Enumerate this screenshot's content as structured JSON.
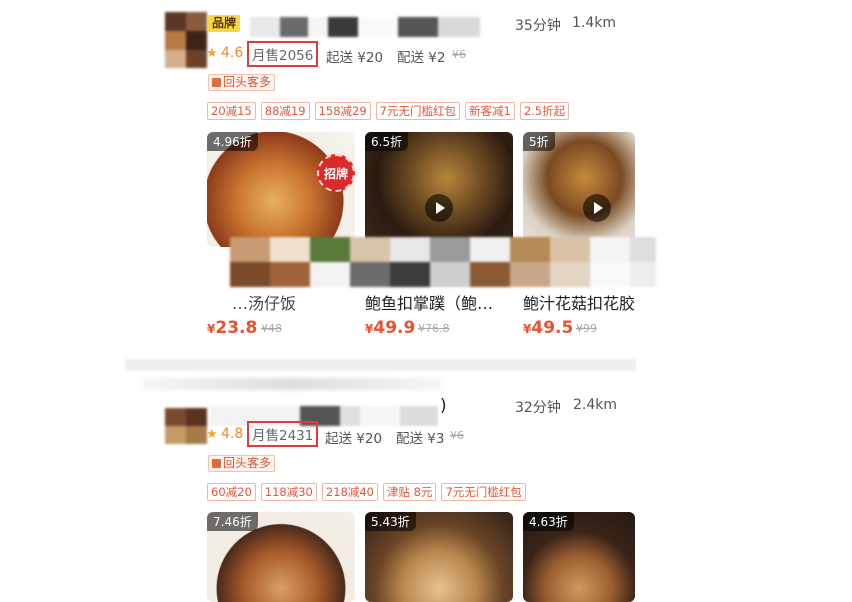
{
  "store1": {
    "badge": "品牌",
    "time": "35分钟",
    "distance": "1.4km",
    "rating": "4.6",
    "monthly_sales": "月售2056",
    "min_order": "起送 ¥20",
    "delivery_fee": "配送 ¥2",
    "delivery_fee_original": "¥6",
    "repeat_tag": "回头客多",
    "promos": [
      "20减15",
      "88减19",
      "158减29",
      "7元无门槛红包",
      "新客减1",
      "2.5折起"
    ],
    "dishes": [
      {
        "discount": "4.96折",
        "name": "…汤仔饭",
        "price": "23.8",
        "original": "¥48",
        "signature": "招牌"
      },
      {
        "discount": "6.5折",
        "name": "鲍鱼扣掌蹼（鲍…",
        "price": "49.9",
        "original": "¥76.8"
      },
      {
        "discount": "5折",
        "name": "鲍汁花菇扣花胶",
        "price": "49.5",
        "original": "¥99"
      }
    ]
  },
  "store2": {
    "title_tail": ")",
    "time": "32分钟",
    "distance": "2.4km",
    "rating": "4.8",
    "monthly_sales": "月售2431",
    "min_order": "起送 ¥20",
    "delivery_fee": "配送 ¥3",
    "delivery_fee_original": "¥6",
    "repeat_tag": "回头客多",
    "promos": [
      "60减20",
      "118减30",
      "218减40",
      "津贴 8元",
      "7元无门槛红包"
    ],
    "dishes": [
      {
        "discount": "7.46折"
      },
      {
        "discount": "5.43折"
      },
      {
        "discount": "4.63折"
      }
    ]
  },
  "currency": "¥",
  "colors": {
    "price": "#e8532c",
    "highlight_box": "#e13b3b",
    "star": "#f5a623",
    "brand_badge": "#f7d648"
  }
}
